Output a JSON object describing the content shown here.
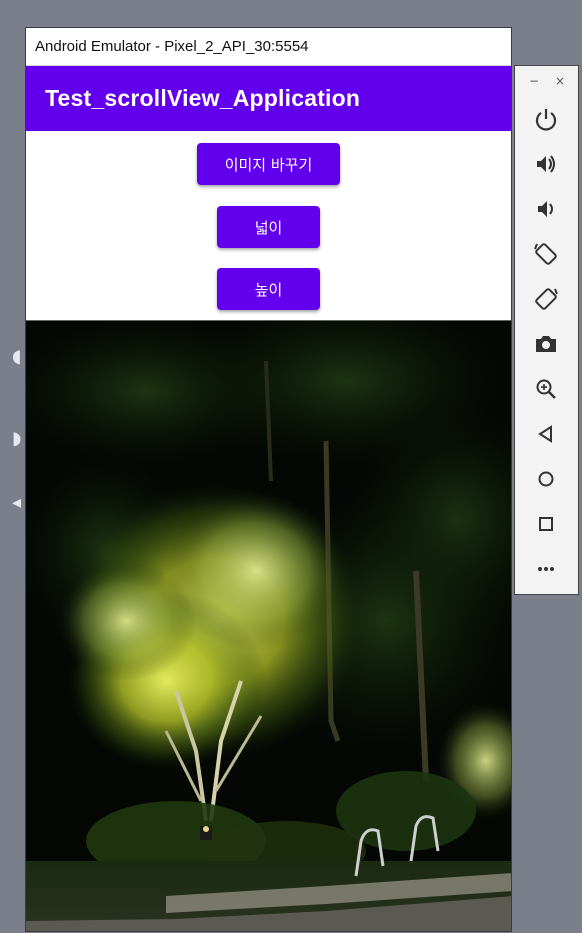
{
  "window": {
    "title": "Android Emulator - Pixel_2_API_30:5554"
  },
  "app": {
    "title": "Test_scrollView_Application",
    "accent_color": "#6200ee"
  },
  "buttons": {
    "change_image": "이미지 바꾸기",
    "width": "넓이",
    "height": "높이"
  },
  "image": {
    "subject": "night garden with illuminated tree",
    "icon": "photo"
  },
  "toolbar": {
    "minimize": "−",
    "close": "×",
    "items": [
      {
        "name": "power-icon"
      },
      {
        "name": "volume-up-icon"
      },
      {
        "name": "volume-down-icon"
      },
      {
        "name": "rotate-left-icon"
      },
      {
        "name": "rotate-right-icon"
      },
      {
        "name": "camera-icon"
      },
      {
        "name": "zoom-icon"
      },
      {
        "name": "back-icon"
      },
      {
        "name": "home-icon"
      },
      {
        "name": "overview-icon"
      },
      {
        "name": "more-icon"
      }
    ]
  }
}
